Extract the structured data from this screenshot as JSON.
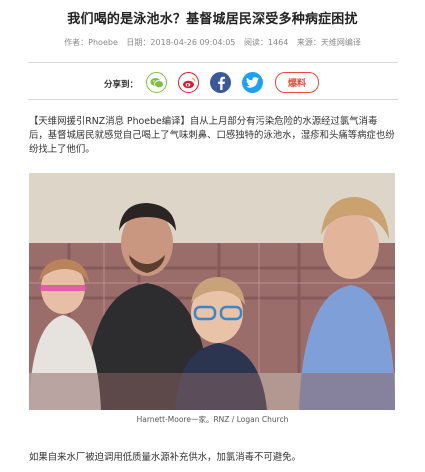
{
  "article": {
    "title": "我们喝的是泳池水？基督城居民深受多种病症困扰",
    "meta": {
      "author": "作者：Phoebe",
      "date": "日期：2018-04-26 09:04:05",
      "views": "阅读：1464",
      "source": "来源：天维网编译"
    },
    "share": {
      "label": "分享到：",
      "report_label": "爆料"
    },
    "intro": "【天维网援引RNZ消息 Phoebe编译】自从上月部分有污染危险的水源经过氯气消毒后，基督城居民就感觉自己喝上了气味刺鼻、口感独特的泳池水，湿疹和头痛等病症也纷纷找上了他们。",
    "photo_caption": "Harnett-Moore一家。RNZ / Logan Church",
    "body_line": "如果自来水厂被迫调用低质量水源补充供水，加氯消毒不可避免。"
  },
  "colors": {
    "wechat": "#7bc142",
    "weibo": "#e6162d",
    "facebook": "#3b5998",
    "twitter": "#1da1f2",
    "report": "#e74c3c"
  }
}
